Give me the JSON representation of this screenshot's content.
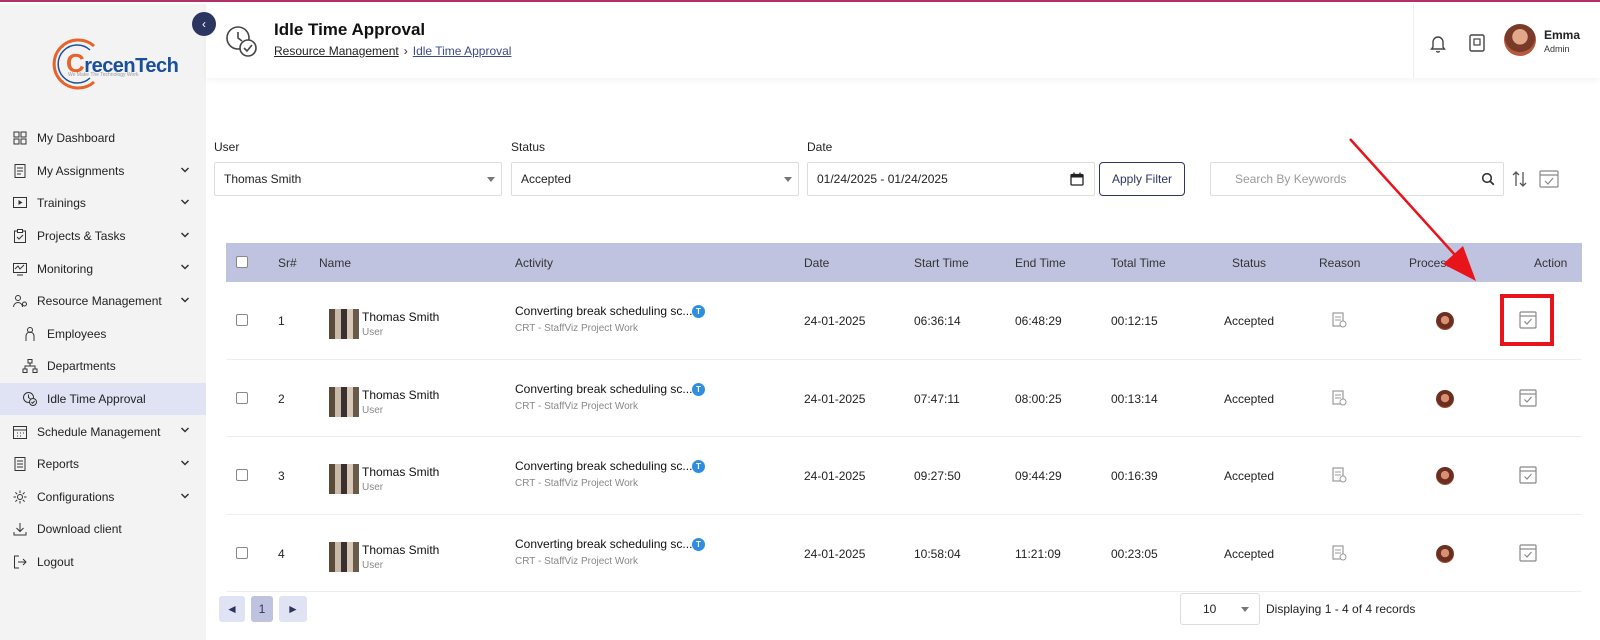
{
  "app": {
    "logo": "recenTech",
    "logo_letter": "C",
    "logo_tagline": "We Make The Technology Work"
  },
  "sidebar": {
    "items": [
      {
        "label": "My Dashboard",
        "icon": "dashboard-icon",
        "chevron": false
      },
      {
        "label": "My Assignments",
        "icon": "assignments-icon",
        "chevron": true
      },
      {
        "label": "Trainings",
        "icon": "trainings-icon",
        "chevron": true
      },
      {
        "label": "Projects & Tasks",
        "icon": "projects-icon",
        "chevron": true
      },
      {
        "label": "Monitoring",
        "icon": "monitoring-icon",
        "chevron": true
      },
      {
        "label": "Resource Management",
        "icon": "resource-icon",
        "chevron": true
      },
      {
        "label": "Employees",
        "icon": "employees-icon",
        "chevron": false,
        "sub": true
      },
      {
        "label": "Departments",
        "icon": "departments-icon",
        "chevron": false,
        "sub": true
      },
      {
        "label": "Idle Time Approval",
        "icon": "idle-time-icon",
        "chevron": false,
        "sub": true,
        "active": true
      },
      {
        "label": "Schedule Management",
        "icon": "schedule-icon",
        "chevron": true
      },
      {
        "label": "Reports",
        "icon": "reports-icon",
        "chevron": true
      },
      {
        "label": "Configurations",
        "icon": "configurations-icon",
        "chevron": true
      },
      {
        "label": "Download client",
        "icon": "download-icon",
        "chevron": false
      },
      {
        "label": "Logout",
        "icon": "logout-icon",
        "chevron": false
      }
    ]
  },
  "header": {
    "title": "Idle Time Approval",
    "breadcrumb": [
      "Resource Management",
      "Idle Time Approval"
    ],
    "breadcrumb_sep": "›",
    "user": {
      "name": "Emma",
      "role": "Admin"
    }
  },
  "filters": {
    "user_label": "User",
    "user_value": "Thomas Smith",
    "status_label": "Status",
    "status_value": "Accepted",
    "date_label": "Date",
    "date_value": "01/24/2025 - 01/24/2025",
    "apply_label": "Apply Filter",
    "search_placeholder": "Search By Keywords"
  },
  "table": {
    "headers": [
      "Sr#",
      "Name",
      "Activity",
      "Date",
      "Start Time",
      "End Time",
      "Total Time",
      "Status",
      "Reason",
      "Processed",
      "Action"
    ],
    "rows": [
      {
        "sr": "1",
        "name": "Thomas Smith",
        "role": "User",
        "activity": "Converting break scheduling sc...",
        "project": "CRT - StaffViz Project Work",
        "badge": "T",
        "date": "24-01-2025",
        "start": "06:36:14",
        "end": "06:48:29",
        "total": "00:12:15",
        "status": "Accepted"
      },
      {
        "sr": "2",
        "name": "Thomas Smith",
        "role": "User",
        "activity": "Converting break scheduling sc...",
        "project": "CRT - StaffViz Project Work",
        "badge": "T",
        "date": "24-01-2025",
        "start": "07:47:11",
        "end": "08:00:25",
        "total": "00:13:14",
        "status": "Accepted"
      },
      {
        "sr": "3",
        "name": "Thomas Smith",
        "role": "User",
        "activity": "Converting break scheduling sc...",
        "project": "CRT - StaffViz Project Work",
        "badge": "T",
        "date": "24-01-2025",
        "start": "09:27:50",
        "end": "09:44:29",
        "total": "00:16:39",
        "status": "Accepted"
      },
      {
        "sr": "4",
        "name": "Thomas Smith",
        "role": "User",
        "activity": "Converting break scheduling sc...",
        "project": "CRT - StaffViz Project Work",
        "badge": "T",
        "date": "24-01-2025",
        "start": "10:58:04",
        "end": "11:21:09",
        "total": "00:23:05",
        "status": "Accepted"
      }
    ]
  },
  "pagination": {
    "prev": "◄",
    "page": "1",
    "next": "►",
    "page_size": "10",
    "records": "Displaying 1 - 4 of 4 records"
  },
  "colors": {
    "accent": "#2c3560",
    "table_header": "#c0c3e0",
    "highlight": "#e8141b",
    "badge": "#2f8ee0"
  }
}
